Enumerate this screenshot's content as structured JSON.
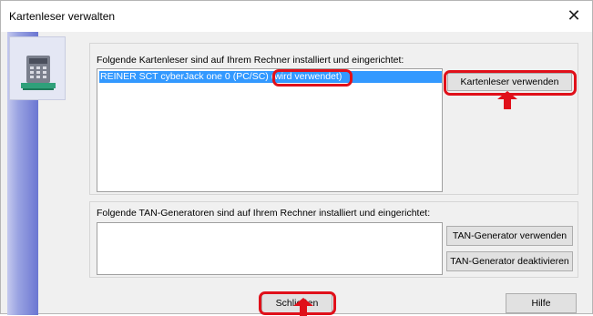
{
  "window": {
    "title": "Kartenleser verwalten",
    "close_glyph": "✕"
  },
  "readers_group": {
    "label": "Folgende Kartenleser sind auf Ihrem Rechner installiert und eingerichtet:",
    "items": [
      {
        "name": "REINER SCT cyberJack one 0 (PC/SC)",
        "status": "(wird verwendet)"
      }
    ],
    "use_button": "Kartenleser verwenden"
  },
  "tan_group": {
    "label": "Folgende TAN-Generatoren sind auf Ihrem Rechner installiert und eingerichtet:",
    "use_button": "TAN-Generator verwenden",
    "deactivate_button": "TAN-Generator deaktivieren"
  },
  "footer": {
    "close_button": "Schließen",
    "help_button": "Hilfe"
  },
  "colors": {
    "accent": "#3399ff",
    "highlight": "#e0101a"
  },
  "icons": {
    "sidebar": "card-reader-icon"
  }
}
